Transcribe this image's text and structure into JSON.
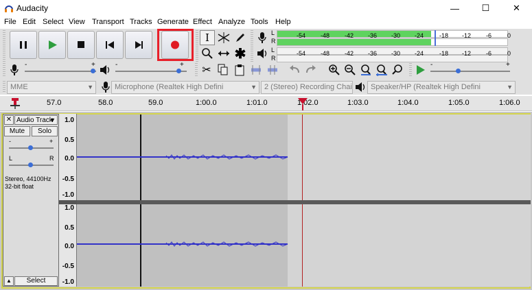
{
  "window": {
    "title": "Audacity",
    "minimize_glyph": "—",
    "maximize_glyph": "☐",
    "close_glyph": "✕"
  },
  "menu": [
    "File",
    "Edit",
    "Select",
    "View",
    "Transport",
    "Tracks",
    "Generate",
    "Effect",
    "Analyze",
    "Tools",
    "Help"
  ],
  "meters": {
    "record_channel_left": "L",
    "record_channel_right": "R",
    "play_channel_left": "L",
    "play_channel_right": "R",
    "record_ticks": [
      "-54",
      "-48",
      "-42",
      "-36",
      "-30",
      "-24",
      "-18",
      "-12",
      "-6",
      "0"
    ],
    "play_ticks": [
      "-54",
      "-48",
      "-42",
      "-36",
      "-30",
      "-24",
      "-18",
      "-12",
      "-6",
      "0"
    ],
    "record_level_fraction": 0.67
  },
  "mixer": {
    "minus": "-",
    "plus": "+"
  },
  "devices": {
    "host": "MME",
    "recording_device": "Microphone (Realtek High Defini",
    "channels": "2 (Stereo) Recording Chai",
    "playback_device": "Speaker/HP (Realtek High Defini"
  },
  "ruler": {
    "ticks": [
      "57.0",
      "58.0",
      "59.0",
      "1:00.0",
      "1:01.0",
      "1:02.0",
      "1:03.0",
      "1:04.0",
      "1:05.0",
      "1:06.0"
    ]
  },
  "track": {
    "name": "Audio Track",
    "mute": "Mute",
    "solo": "Solo",
    "gain_minus": "-",
    "gain_plus": "+",
    "pan_left": "L",
    "pan_right": "R",
    "info_line1": "Stereo, 44100Hz",
    "info_line2": "32-bit float",
    "select": "Select",
    "close_glyph": "✕",
    "collapse_glyph": "▲",
    "menu_glyph": "▼",
    "vruler_labels": [
      "1.0",
      "0.5",
      "0.0",
      "-0.5",
      "-1.0"
    ]
  },
  "colors": {
    "meter_green": "#5fd35f",
    "waveform_blue": "#3232c8",
    "record_red": "#e01b24",
    "play_green": "#2e9e3e",
    "highlight_box": "#e8202a",
    "cursor_red": "#b22222"
  }
}
